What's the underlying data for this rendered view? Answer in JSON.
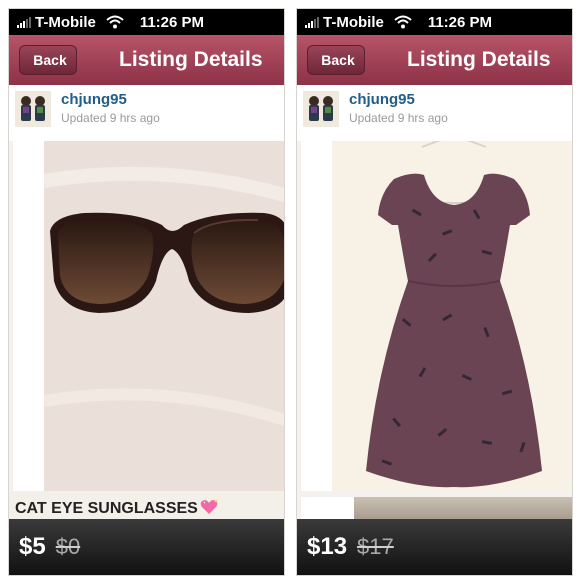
{
  "screens": [
    {
      "status_bar": {
        "carrier": "T-Mobile",
        "time": "11:26 PM"
      },
      "nav": {
        "back_label": "Back",
        "title": "Listing Details"
      },
      "seller": {
        "username": "chjung95",
        "updated": "Updated 9 hrs ago"
      },
      "listing": {
        "title": "CAT EYE SUNGLASSES",
        "price": "$5",
        "original_price": "$0",
        "image_subject": "sunglasses"
      }
    },
    {
      "status_bar": {
        "carrier": "T-Mobile",
        "time": "11:26 PM"
      },
      "nav": {
        "back_label": "Back",
        "title": "Listing Details"
      },
      "seller": {
        "username": "chjung95",
        "updated": "Updated 9 hrs ago"
      },
      "listing": {
        "price": "$13",
        "original_price": "$17",
        "image_subject": "dress"
      }
    }
  ],
  "colors": {
    "nav_bar": "#a04358",
    "username": "#1f5d8d",
    "price_bar": "#1e1e1e"
  }
}
